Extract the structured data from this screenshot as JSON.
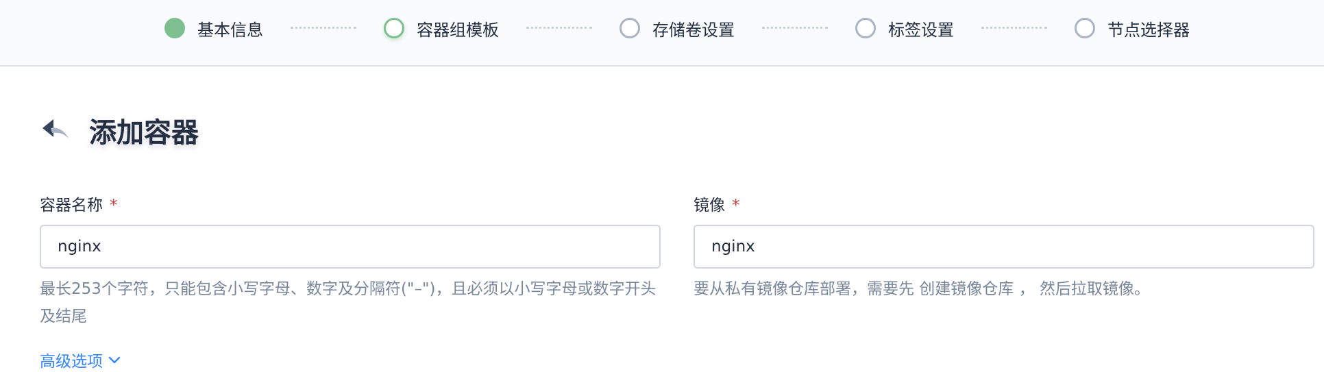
{
  "stepper": {
    "steps": [
      {
        "label": "基本信息",
        "state": "done"
      },
      {
        "label": "容器组模板",
        "state": "active"
      },
      {
        "label": "存储卷设置",
        "state": "pending"
      },
      {
        "label": "标签设置",
        "state": "pending"
      },
      {
        "label": "节点选择器",
        "state": "pending"
      }
    ]
  },
  "header": {
    "back_icon": "back-arrow-icon",
    "title": "添加容器"
  },
  "form": {
    "container_name": {
      "label": "容器名称",
      "required_mark": "*",
      "value": "nginx",
      "description": "最长253个字符，只能包含小写字母、数字及分隔符(\"–\")，且必须以小写字母或数字开头及结尾"
    },
    "image": {
      "label": "镜像",
      "required_mark": "*",
      "value": "nginx",
      "description": "要从私有镜像仓库部署，需要先 创建镜像仓库 ， 然后拉取镜像。"
    }
  },
  "advanced": {
    "label": "高级选项",
    "icon": "chevron-down-icon"
  },
  "colors": {
    "done": "#7ebf8f",
    "pending": "#abb4c4",
    "required": "#c03e3e",
    "link": "#3385ff"
  }
}
